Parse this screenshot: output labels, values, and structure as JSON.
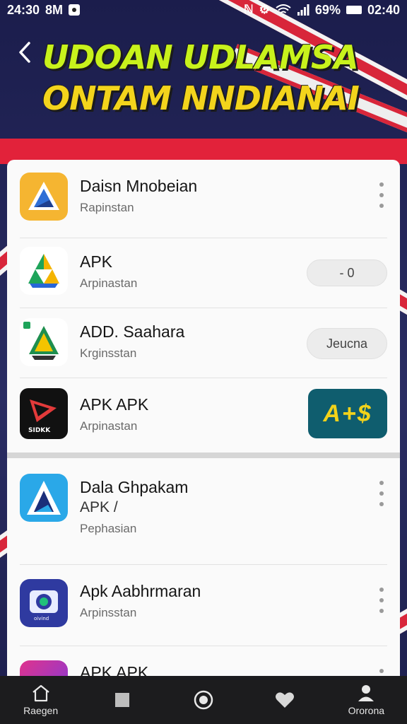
{
  "status_bar": {
    "time_left": "24:30",
    "carrier": "8M",
    "battery_pct": "69%",
    "time_right": "02:40"
  },
  "header": {
    "back_icon": "chevron-left-icon",
    "headline_line1": "UDOAN UDLAMSA",
    "headline_line2": "ONTAM NNDIANAI"
  },
  "apps": [
    {
      "title": "Daisn Mnobeian",
      "subtitle": "Rapinstan",
      "action": "menu"
    },
    {
      "title": "APK",
      "subtitle": "Arpinastan",
      "action": "pill",
      "action_label": "- 0"
    },
    {
      "title": "ADD. Saahara",
      "subtitle": "Krginsstan",
      "action": "pill",
      "action_label": "Jeucna"
    },
    {
      "title": "APK APK",
      "subtitle": "Arpinastan",
      "action": "price",
      "action_label": "A+$"
    },
    {
      "title": "Dala Ghpakam",
      "version": "APK /",
      "subtitle": "Pephasian",
      "action": "menu"
    },
    {
      "title": "Apk Aabhrmaran",
      "subtitle": "Arpinsstan",
      "action": "menu"
    },
    {
      "title": "APK APK",
      "action": "menu"
    }
  ],
  "bottom_nav": [
    {
      "label": "Raegen",
      "icon": "home-icon"
    },
    {
      "label": "",
      "icon": "square-icon"
    },
    {
      "label": "",
      "icon": "circle-icon"
    },
    {
      "label": "",
      "icon": "heart-icon"
    },
    {
      "label": "Ororona",
      "icon": "profile-icon"
    }
  ],
  "colors": {
    "headline_green": "#c8f21c",
    "headline_yellow": "#f3d41c",
    "price_bg": "#0f5d6e",
    "nav_bg": "#1c1c1e"
  }
}
